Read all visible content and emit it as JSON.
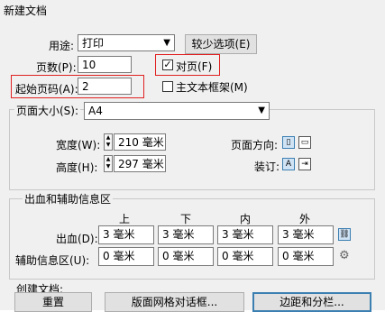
{
  "window": {
    "title": "新建文档"
  },
  "usage": {
    "label": "用途:",
    "value": "打印"
  },
  "fewer_options_button": "较少选项(E)",
  "pages": {
    "label": "页数(P):",
    "value": "10"
  },
  "facing_pages": {
    "label": "对页(F)",
    "checked": true
  },
  "start_page": {
    "label": "起始页码(A):",
    "value": "2"
  },
  "master_text_frame": {
    "label": "主文本框架(M)",
    "checked": false
  },
  "page_size": {
    "label": "页面大小(S):",
    "value": "A4",
    "width_label": "宽度(W):",
    "width_value": "210 毫米",
    "height_label": "高度(H):",
    "height_value": "297 毫米",
    "orientation_label": "页面方向:",
    "binding_label": "装订:"
  },
  "bleed_slug": {
    "group_label": "出血和辅助信息区",
    "columns": [
      "上",
      "下",
      "内",
      "外"
    ],
    "bleed_label": "出血(D):",
    "bleed_values": [
      "3 毫米",
      "3 毫米",
      "3 毫米",
      "3 毫米"
    ],
    "slug_label": "辅助信息区(U):",
    "slug_values": [
      "0 毫米",
      "0 毫米",
      "0 毫米",
      "0 毫米"
    ]
  },
  "create_document": {
    "label": "创建文档:",
    "reset_button": "重置",
    "layout_grid_button": "版面网格对话框...",
    "margins_columns_button": "边距和分栏..."
  },
  "colors": {
    "highlight_box": "#e02020",
    "primary_border": "#3c7fb1"
  }
}
